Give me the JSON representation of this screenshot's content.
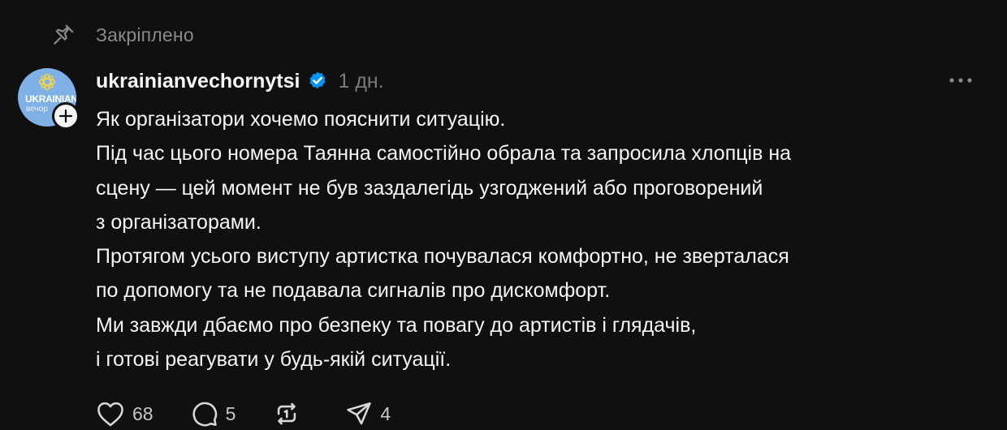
{
  "pinned": {
    "icon": "pin-icon",
    "label": "Закріплено"
  },
  "post": {
    "avatar": {
      "brand": "UKRAINIAN",
      "sub": "вечор",
      "color": "#7fb0e6"
    },
    "username": "ukrainianvechornytsi",
    "verified_icon": "verified-badge-icon",
    "timestamp": "1 дн.",
    "more_icon": "more-icon",
    "lines": [
      "Як організатори хочемо пояснити ситуацію.",
      "Під час цього номера Таянна самостійно обрала та запросила хлопців на",
      "сцену — цей момент не був заздалегідь узгоджений або проговорений",
      "з організаторами.",
      "Протягом усього виступу артистка почувалася комфортно, не зверталася",
      "по допомогу та не подавала сигналів про дискомфорт.",
      "Ми завжди дбаємо про безпеку та повагу до артистів і глядачів,",
      "і готові реагувати у будь-якій ситуації."
    ]
  },
  "actions": {
    "like": {
      "icon": "heart-icon",
      "count": "68"
    },
    "reply": {
      "icon": "comment-icon",
      "count": "5"
    },
    "repost": {
      "icon": "repost-icon",
      "count": ""
    },
    "share": {
      "icon": "send-icon",
      "count": "4"
    }
  },
  "colors": {
    "background": "#101010",
    "text_primary": "#f3f5f7",
    "text_secondary": "#7a7a7a",
    "verified": "#0095f6"
  }
}
